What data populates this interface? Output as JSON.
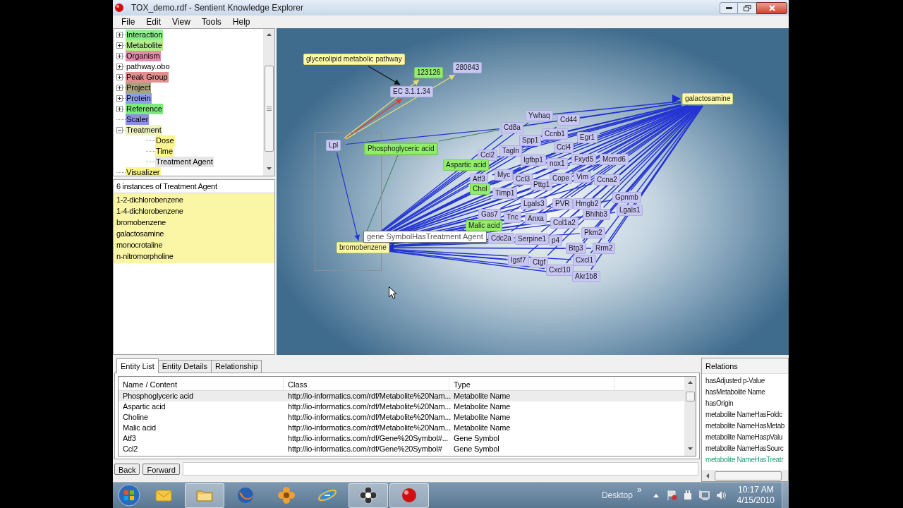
{
  "window": {
    "title": "TOX_demo.rdf - Sentient Knowledge Explorer"
  },
  "menu": [
    "File",
    "Edit",
    "View",
    "Tools",
    "Help"
  ],
  "tree": [
    {
      "label": "Interaction",
      "kind": "folder",
      "expanded": false,
      "color": "#8ef08e"
    },
    {
      "label": "Metabolite",
      "kind": "folder",
      "expanded": false,
      "color": "#b2ee8c"
    },
    {
      "label": "Organism",
      "kind": "folder",
      "expanded": false,
      "color": "#e48cb0"
    },
    {
      "label": "pathway.obo",
      "kind": "folder",
      "expanded": false
    },
    {
      "label": "Peak Group",
      "kind": "folder",
      "expanded": false,
      "color": "#e38f8f"
    },
    {
      "label": "Project",
      "kind": "folder",
      "expanded": false,
      "color": "#aaa27c"
    },
    {
      "label": "Protein",
      "kind": "folder",
      "expanded": false,
      "color": "#8e9ee8"
    },
    {
      "label": "Reference",
      "kind": "folder",
      "expanded": false,
      "color": "#7fe87f"
    },
    {
      "label": "Scaler",
      "kind": "leaf",
      "color": "#8f8ee6"
    },
    {
      "label": "Treatment",
      "kind": "folder",
      "expanded": true,
      "color": "#eef3c2",
      "children": [
        {
          "label": "Dose",
          "kind": "leaf",
          "selected": false,
          "color": "#fbf68a"
        },
        {
          "label": "Time",
          "kind": "leaf",
          "selected": false,
          "color": "#fbf68a"
        },
        {
          "label": "Treatment Agent",
          "kind": "leaf",
          "selected": true
        }
      ]
    },
    {
      "label": "Visualizer",
      "kind": "leaf",
      "color": "#fbf68a"
    }
  ],
  "instances": {
    "title": "6 instances of Treatment Agent",
    "items": [
      "1-2-dichlorobenzene",
      "1-4-dichlorobenzene",
      "bromobenzene",
      "galactosamine",
      "monocrotaline",
      "n-nitromorpholine"
    ]
  },
  "graph": {
    "tooltip": "gene SymbolHasTreatment Agent",
    "nodes": [
      {
        "label": "glycerolipid metabolic pathway",
        "kind": "agent",
        "selected": false
      },
      {
        "label": "123126",
        "kind": "metabolite",
        "selected": false
      },
      {
        "label": "280843",
        "kind": "gene",
        "selected": false
      },
      {
        "label": "EC 3.1.1.34",
        "kind": "gene",
        "selected": false
      },
      {
        "label": "galactosamine",
        "kind": "agent",
        "selected": false
      },
      {
        "label": "Lpl",
        "kind": "gene",
        "selected": false
      },
      {
        "label": "Phosphoglyceric acid",
        "kind": "metabolite",
        "selected": true
      },
      {
        "label": "bromobenzene",
        "kind": "agent",
        "selected": false
      },
      {
        "label": "Ywhaq",
        "kind": "gene",
        "selected": false
      },
      {
        "label": "Cd44",
        "kind": "gene",
        "selected": false
      },
      {
        "label": "Cd8a",
        "kind": "gene",
        "selected": false
      },
      {
        "label": "Ccnb1",
        "kind": "gene",
        "selected": false
      },
      {
        "label": "Spp1",
        "kind": "gene",
        "selected": false
      },
      {
        "label": "Egr1",
        "kind": "gene",
        "selected": false
      },
      {
        "label": "Ccl4",
        "kind": "gene",
        "selected": false
      },
      {
        "label": "Tagln",
        "kind": "gene",
        "selected": false
      },
      {
        "label": "Ccl2",
        "kind": "gene",
        "selected": false
      },
      {
        "label": "Igfbp1",
        "kind": "gene",
        "selected": false
      },
      {
        "label": "nox1",
        "kind": "gene",
        "selected": false
      },
      {
        "label": "Fxyd5",
        "kind": "gene",
        "selected": false
      },
      {
        "label": "Mcmd6",
        "kind": "gene",
        "selected": false
      },
      {
        "label": "Aspartic acid",
        "kind": "metabolite",
        "selected": false
      },
      {
        "label": "Atf3",
        "kind": "gene",
        "selected": false
      },
      {
        "label": "Myc",
        "kind": "gene",
        "selected": false
      },
      {
        "label": "Ccl3",
        "kind": "gene",
        "selected": false
      },
      {
        "label": "Cope",
        "kind": "gene",
        "selected": false
      },
      {
        "label": "Vim",
        "kind": "gene",
        "selected": false
      },
      {
        "label": "Ccna2",
        "kind": "gene",
        "selected": false
      },
      {
        "label": "Pttg1",
        "kind": "gene",
        "selected": false
      },
      {
        "label": "Chol",
        "kind": "metabolite",
        "selected": false
      },
      {
        "label": "Timp1",
        "kind": "gene",
        "selected": false
      },
      {
        "label": "Lgals3",
        "kind": "gene",
        "selected": false
      },
      {
        "label": "PVR",
        "kind": "gene",
        "selected": false
      },
      {
        "label": "Hmgb2",
        "kind": "gene",
        "selected": false
      },
      {
        "label": "Gpnmb",
        "kind": "gene",
        "selected": false
      },
      {
        "label": "Bhlhb3",
        "kind": "gene",
        "selected": false
      },
      {
        "label": "Lgals1",
        "kind": "gene",
        "selected": false
      },
      {
        "label": "Gas7",
        "kind": "gene",
        "selected": false
      },
      {
        "label": "Tnc",
        "kind": "gene",
        "selected": false
      },
      {
        "label": "Anxa",
        "kind": "gene",
        "selected": false
      },
      {
        "label": "Col1a2",
        "kind": "gene",
        "selected": false
      },
      {
        "label": "Pkm2",
        "kind": "gene",
        "selected": false
      },
      {
        "label": "Malic acid",
        "kind": "metabolite",
        "selected": false
      },
      {
        "label": "Cdc2a",
        "kind": "gene",
        "selected": false
      },
      {
        "label": "Serpine1",
        "kind": "gene",
        "selected": false
      },
      {
        "label": "p4",
        "kind": "gene",
        "selected": false
      },
      {
        "label": "Btg3",
        "kind": "gene",
        "selected": false
      },
      {
        "label": "Rrm2",
        "kind": "gene",
        "selected": false
      },
      {
        "label": "Igsf7",
        "kind": "gene",
        "selected": false
      },
      {
        "label": "Ctgf",
        "kind": "gene",
        "selected": false
      },
      {
        "label": "Cxcl1",
        "kind": "gene",
        "selected": false
      },
      {
        "label": "Cxcl10",
        "kind": "gene",
        "selected": false
      },
      {
        "label": "Akr1b8",
        "kind": "gene",
        "selected": false
      }
    ]
  },
  "tabs": [
    {
      "label": "Entity List",
      "selected": true
    },
    {
      "label": "Entity Details",
      "selected": false
    },
    {
      "label": "Relationship",
      "selected": false
    }
  ],
  "table": {
    "columns": [
      "Name / Content",
      "Class",
      "Type"
    ],
    "rows": [
      {
        "cells": [
          "Phosphoglyceric acid",
          "http://io-informatics.com/rdf/Metabolite%20Nam...",
          "Metabolite Name"
        ],
        "selected": true
      },
      {
        "cells": [
          "Aspartic acid",
          "http://io-informatics.com/rdf/Metabolite%20Nam...",
          "Metabolite Name"
        ],
        "selected": false
      },
      {
        "cells": [
          "Choline",
          "http://io-informatics.com/rdf/Metabolite%20Nam...",
          "Metabolite Name"
        ],
        "selected": false
      },
      {
        "cells": [
          "Malic acid",
          "http://io-informatics.com/rdf/Metabolite%20Nam...",
          "Metabolite Name"
        ],
        "selected": false
      },
      {
        "cells": [
          "Atf3",
          "http://io-informatics.com/rdf/Gene%20Symbol#...",
          "Gene Symbol"
        ],
        "selected": false
      },
      {
        "cells": [
          "Ccl2",
          "http://io-informatics.com/rdf/Gene%20Symbol#",
          "Gene Symbol"
        ],
        "selected": false
      }
    ]
  },
  "nav_buttons": [
    "Back",
    "Forward"
  ],
  "relations": {
    "title": "Relations",
    "items": [
      {
        "label": "hasAdjusted p-Value",
        "selected": false
      },
      {
        "label": "hasMetabolite Name",
        "selected": false
      },
      {
        "label": "hasOrigin",
        "selected": false
      },
      {
        "label": "metabolite NameHasFoldc",
        "selected": false
      },
      {
        "label": "metabolite NameHasMetab",
        "selected": false
      },
      {
        "label": "metabolite NameHaspValu",
        "selected": false
      },
      {
        "label": "metabolite NameHasSourc",
        "selected": false
      },
      {
        "label": "metabolite NameHasTreatr",
        "selected": true
      }
    ]
  },
  "taskbar": {
    "apps": [
      {
        "kind": "mail",
        "active": false
      },
      {
        "kind": "folder",
        "active": true
      },
      {
        "kind": "firefox",
        "active": false
      },
      {
        "kind": "flower",
        "active": false
      },
      {
        "kind": "ie",
        "active": false
      },
      {
        "kind": "dark-flower",
        "active": true
      },
      {
        "kind": "red-ball",
        "active": true
      }
    ],
    "toolbar_label": "Desktop",
    "toolbar_chevron": "»",
    "time": "10:17 AM",
    "date": "4/15/2010"
  }
}
